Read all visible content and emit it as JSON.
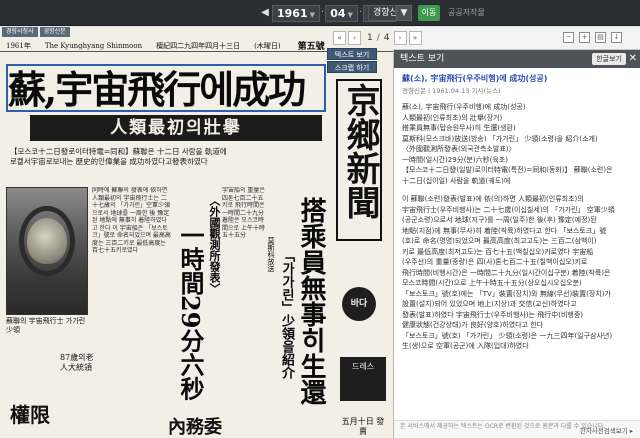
{
  "topbar": {
    "year": "1961",
    "month": "04",
    "day": "13",
    "newspaper": "경향신문",
    "go_label": "▼",
    "view_label": "이동",
    "link_label": "공공저작물"
  },
  "subbar": {
    "page_current": "1",
    "page_total": "4"
  },
  "paper": {
    "tabs": [
      "경향시청사",
      "경향신문"
    ],
    "masthead_line": [
      "1961年",
      "The Kyunghyang Shinmoon",
      "檀紀四二九四年四月十三日",
      "(木曜日)"
    ],
    "section_label": "第五號",
    "float_text_view": "텍스트 보기",
    "float_script_view": "스크랩 하기",
    "headline": "蘇,宇宙飛行에成功",
    "banner": "人類最初의壯擧",
    "lead": [
      "【모스코十二日發로이터特電=同和】蘇聯은 十二日 사람을 軌道에",
      "로켙서宇宙로보내는 歷史的인偉業을 成功하였다고發表하였다"
    ],
    "vert_sub": "〈外國觀測所發表〉",
    "vert_big": "一時間29分六秒",
    "vert_crew": "搭乘員無事히生還",
    "vert_crew_sub": "「가가린」少領을紹介",
    "vert_tiny": "莫斯科放送",
    "photo_caption": "蘇聯의 宇宙飛行士 가가린少領",
    "col_a": "同時에 蘇聯의 發表에 依하면 人類最初의 宇宙飛行士는 二十七歲의 「가가린」空軍少領으로서 地球를 一周한 後 豫定된 地點에 無事히 着陸하였다고 한다 이 宇宙船은 「보스토크」號로 命名되었으며 最高高度는 三百二키로 最低高度는 百七十五키로였다",
    "col_b": "宇宙船의 重量은 四톤七百二十五키로 飛行時間은 一時間二十九分 着陸은 모스코時間으로 上午十時五十五分",
    "bottom_small": "87歲의老人大統領",
    "bottom_head": "權限",
    "bottom_head_2": "內務委",
    "mast": "京鄉新聞",
    "ad_circle": "바다",
    "ad_box": "드레스",
    "ad_date": "五月十日 發賣"
  },
  "panel": {
    "header": "텍스트 보기",
    "lang_button": "한글보기",
    "close": "✕",
    "title": "蘇(소), 宇宙飛行(우주비행)에 成功(성공)",
    "meta": "경향신문 | 1961.04.13 기사(뉴스)",
    "lines": [
      "蘇(소), 宇宙飛行(우주비행)에 成功(성공)",
      "人類最初(인류최초)의 壯擧(장거)",
      "搭乘員無事(탑승원무사)히 生還(생환)",
      "莫斯科(모스크바)放送(방송) 「가가린」 少領(소령)을 紹介(소개)",
      "〈外國觀測所發表(외국관측소발표)〉",
      "一時間(일시간)29分(분)六秒(육초)",
      "【모스코十二日發(일발)로이터特電(특전)=同和(동화)】 蘇聯(소련)은",
      "十二日(십이일) 사람을 軌道(궤도)에",
      "",
      "이 蘇聯(소련)發表(발표)에 依(의)하면 人類最初(인류최초)의",
      "宇宙飛行士(우주비행사)는 二十七歲(이십칠세)의 「가가린」 空軍少領",
      "(공군소령)으로서 地球(지구)를 一周(일주)한 後(후) 豫定(예정)된",
      "地點(지점)에 無事(무사)히 着陸(착륙)하였다고 한다 「보스토크」號",
      "(호)로 命名(명명)되었으며 最高高度(최고고도)는 三百二(삼백이)",
      "키로 最低高度(최저고도)는 百七十五(백칠십오)키로였다 宇宙船",
      "(우주선)의 重量(중량)은 四(사)톤七百二十五(칠백이십오)키로",
      "飛行時間(비행시간)은 一時間二十九分(일시간이십구분) 着陸(착륙)은",
      "모스코時間(시간)으로 上午十時五十五分(상오십시오십오분)",
      "「보스토크」號(호)에는 「TV」裝置(장치)와 無線(무선)裝置(장치)가",
      "設置(설치)되어 있었으며 地上(지상)과 交信(교신)하였다고",
      "發表(발표)하였다 宇宙飛行士(우주비행사)는 飛行中(비행중)",
      "健康狀態(건강상태)가 良好(양호)하였다고 한다",
      "「보스토크」號(호) 「가가린」 少領(소령)은 一九三四年(일구삼사년)",
      "生(생)으로 空軍(공군)에 入隊(입대)하였다"
    ],
    "footer": "본 서비스에서 제공하는 텍스트는 OCR로 변환된 것으로 원문과 다를 수 있습니다.",
    "footer_link": "한자사전검색보기 ▸"
  },
  "colors": {
    "accent_green": "#3d9a4f",
    "panel_header": "#4d5359",
    "link_blue": "#2b4fb3"
  }
}
